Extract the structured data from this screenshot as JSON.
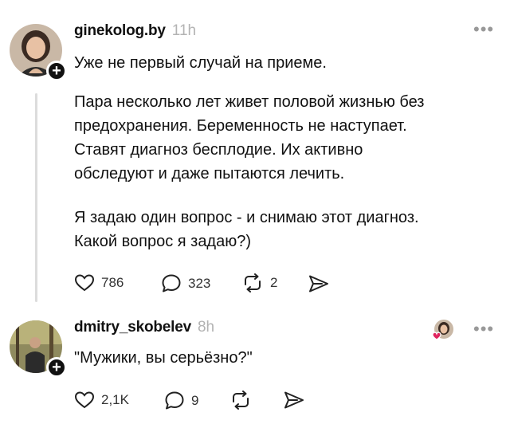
{
  "post1": {
    "username": "ginekolog.by",
    "time": "11h",
    "first_line": "Уже не первый случай на приеме.",
    "paragraph1": "Пара несколько лет живет половой жизнью без\nпредохранения. Беременность не наступает.\nСтавят диагноз бесплодие. Их активно\nобследуют и даже пытаются лечить.",
    "paragraph2": "Я задаю один вопрос - и снимаю этот диагноз.\nКакой вопрос я задаю?)",
    "likes": "786",
    "comments": "323",
    "reposts": "2"
  },
  "post2": {
    "username": "dmitry_skobelev",
    "time": "8h",
    "text": "\"Мужики, вы серьёзно?\"",
    "likes": "2,1K",
    "comments": "9"
  },
  "icons": {
    "more": "more-icon",
    "like": "heart-icon",
    "comment": "comment-icon",
    "repost": "repost-icon",
    "share": "share-icon",
    "follow": "plus-icon"
  }
}
